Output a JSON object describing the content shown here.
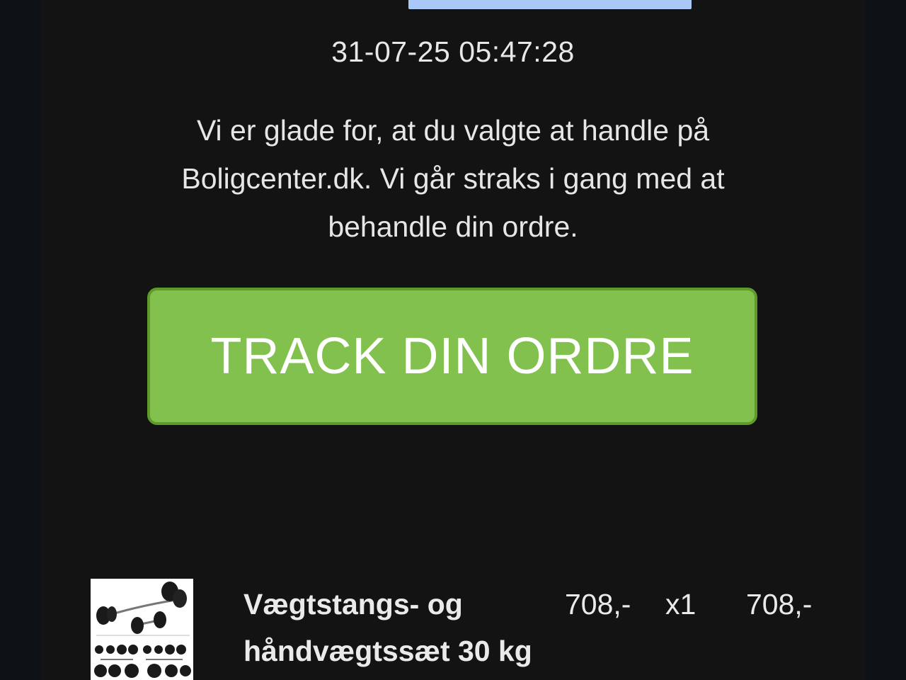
{
  "header": {
    "timestamp": "31-07-25 05:47:28"
  },
  "message": {
    "line1": "Vi er glade for, at du valgte at handle på",
    "line2": "Boligcenter.dk. Vi går straks i gang med at",
    "line3": "behandle din ordre."
  },
  "cta": {
    "label": "TRACK DIN ORDRE"
  },
  "order": {
    "items": [
      {
        "name_line1": "Vægtstangs- og",
        "name_line2": "håndvægtssæt 30 kg",
        "unit_price": "708,-",
        "quantity": "x1",
        "total": "708,-"
      }
    ]
  },
  "colors": {
    "background": "#131313",
    "cta_green": "#82c14e",
    "accent_bar": "#a9c8f7"
  }
}
